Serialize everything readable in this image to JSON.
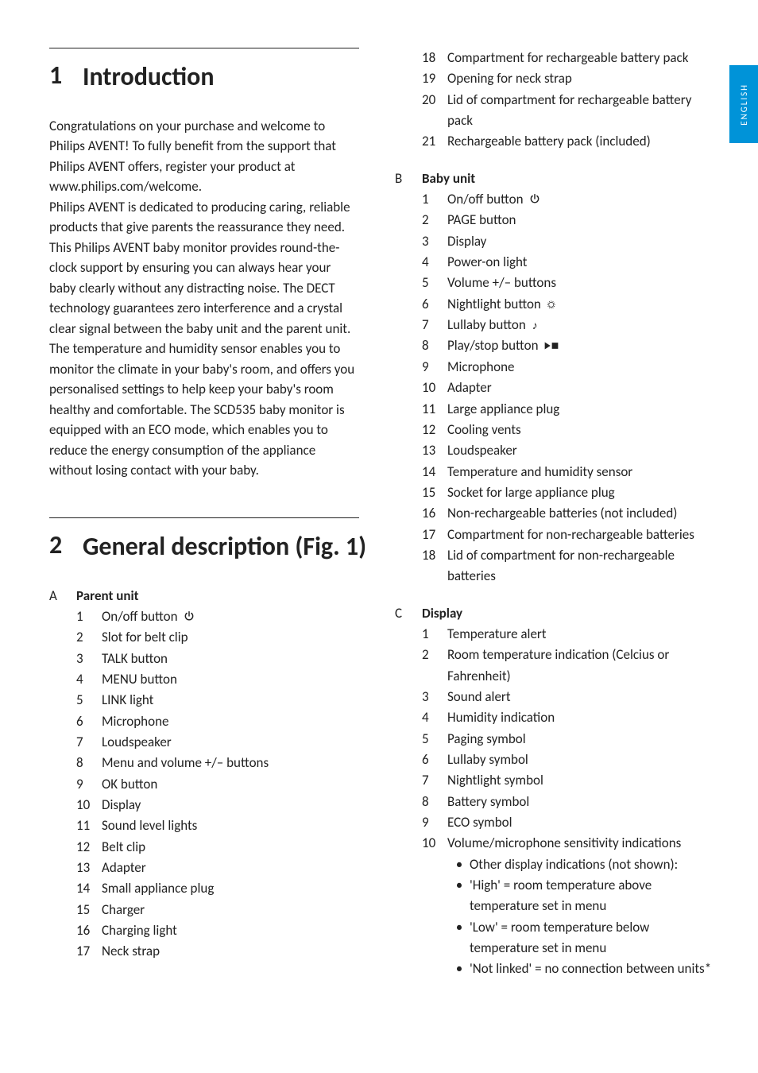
{
  "side_tab": "ENGLISH",
  "section1": {
    "num": "1",
    "title": "Introduction",
    "body": "Congratulations on your purchase and welcome to Philips AVENT! To fully benefit from the support that Philips AVENT offers, register your product at www.philips.com/welcome.\nPhilips AVENT is dedicated to producing caring, reliable products that give parents the reassurance they need. This Philips AVENT baby monitor provides round-the-clock support by ensuring you can always hear your baby clearly without any distracting noise. The DECT technology guarantees zero interference and a crystal clear signal between the baby unit and the parent unit. The temperature and humidity sensor enables you to monitor the climate in your baby's room, and offers you personalised settings to help keep your baby's room healthy and comfortable. The SCD535 baby monitor is equipped with an ECO mode, which enables you to reduce the energy consumption of the appliance without losing contact with your baby."
  },
  "section2": {
    "num": "2",
    "title": "General description (Fig. 1)"
  },
  "groupA": {
    "letter": "A",
    "title": "Parent unit",
    "items": [
      {
        "n": "1",
        "t": "On/off button",
        "icon": "power"
      },
      {
        "n": "2",
        "t": "Slot for belt clip"
      },
      {
        "n": "3",
        "t": "TALK button"
      },
      {
        "n": "4",
        "t": "MENU button"
      },
      {
        "n": "5",
        "t": "LINK light"
      },
      {
        "n": "6",
        "t": "Microphone"
      },
      {
        "n": "7",
        "t": "Loudspeaker"
      },
      {
        "n": "8",
        "t": "Menu and volume +/–  buttons"
      },
      {
        "n": "9",
        "t": "OK button"
      },
      {
        "n": "10",
        "t": "Display"
      },
      {
        "n": "11",
        "t": "Sound level lights"
      },
      {
        "n": "12",
        "t": "Belt clip"
      },
      {
        "n": "13",
        "t": "Adapter"
      },
      {
        "n": "14",
        "t": "Small appliance plug"
      },
      {
        "n": "15",
        "t": "Charger"
      },
      {
        "n": "16",
        "t": "Charging light"
      },
      {
        "n": "17",
        "t": "Neck strap"
      },
      {
        "n": "18",
        "t": "Compartment for rechargeable battery pack"
      },
      {
        "n": "19",
        "t": "Opening for neck strap"
      },
      {
        "n": "20",
        "t": "Lid of compartment for rechargeable battery pack"
      },
      {
        "n": "21",
        "t": "Rechargeable battery pack (included)"
      }
    ]
  },
  "groupB": {
    "letter": "B",
    "title": "Baby unit",
    "items": [
      {
        "n": "1",
        "t": "On/off button",
        "icon": "power"
      },
      {
        "n": "2",
        "t": "PAGE button"
      },
      {
        "n": "3",
        "t": "Display"
      },
      {
        "n": "4",
        "t": "Power-on light"
      },
      {
        "n": "5",
        "t": "Volume +/– buttons"
      },
      {
        "n": "6",
        "t": "Nightlight button",
        "icon": "sun"
      },
      {
        "n": "7",
        "t": "Lullaby button",
        "icon": "note"
      },
      {
        "n": "8",
        "t": "Play/stop button",
        "icon": "playstop"
      },
      {
        "n": "9",
        "t": "Microphone"
      },
      {
        "n": "10",
        "t": "Adapter"
      },
      {
        "n": "11",
        "t": "Large appliance plug"
      },
      {
        "n": "12",
        "t": "Cooling vents"
      },
      {
        "n": "13",
        "t": "Loudspeaker"
      },
      {
        "n": "14",
        "t": "Temperature and humidity sensor"
      },
      {
        "n": "15",
        "t": "Socket for large appliance plug"
      },
      {
        "n": "16",
        "t": "Non-rechargeable batteries (not included)"
      },
      {
        "n": "17",
        "t": "Compartment for non-rechargeable batteries"
      },
      {
        "n": "18",
        "t": "Lid of compartment for non-rechargeable batteries"
      }
    ]
  },
  "groupC": {
    "letter": "C",
    "title": "Display",
    "items": [
      {
        "n": "1",
        "t": "Temperature alert"
      },
      {
        "n": "2",
        "t": "Room temperature indication (Celcius or Fahrenheit)"
      },
      {
        "n": "3",
        "t": "Sound alert"
      },
      {
        "n": "4",
        "t": "Humidity indication"
      },
      {
        "n": "5",
        "t": "Paging symbol"
      },
      {
        "n": "6",
        "t": "Lullaby symbol"
      },
      {
        "n": "7",
        "t": "Nightlight symbol"
      },
      {
        "n": "8",
        "t": "Battery symbol"
      },
      {
        "n": "9",
        "t": "ECO symbol"
      },
      {
        "n": "10",
        "t": "Volume/microphone sensitivity indications"
      }
    ],
    "bullets": [
      "Other display indications (not shown):",
      "'High' = room temperature above temperature set in menu",
      "'Low' = room temperature below temperature set in menu",
      "'Not linked' = no connection between units*"
    ]
  }
}
